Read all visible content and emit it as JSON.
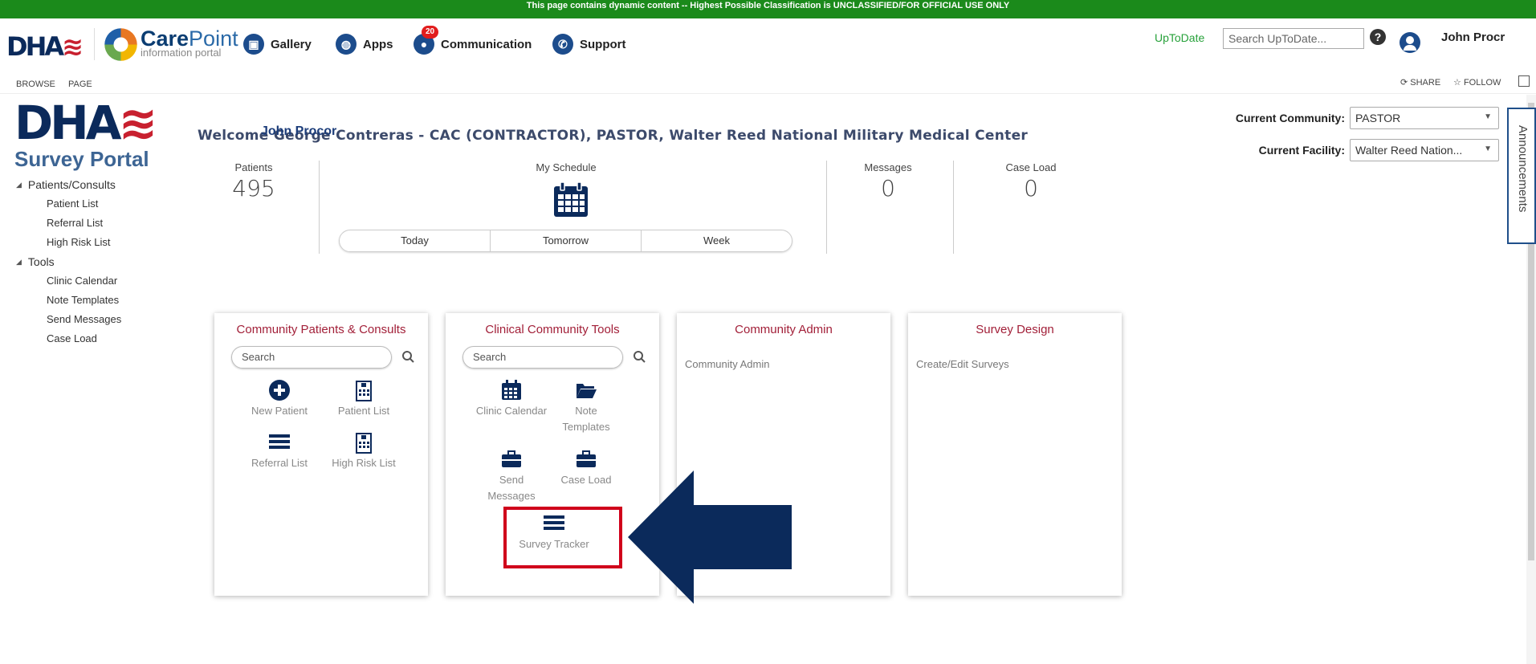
{
  "banner": {
    "text": "This page contains dynamic content -- Highest Possible Classification is UNCLASSIFIED/FOR OFFICIAL USE ONLY"
  },
  "header": {
    "dha_logo": "DHA",
    "carepoint_title": "Care",
    "carepoint_title2": "Point",
    "carepoint_sub": "information portal",
    "nav": [
      {
        "label": "Gallery",
        "icon": "gallery-icon"
      },
      {
        "label": "Apps",
        "icon": "globe-icon"
      },
      {
        "label": "Communication",
        "icon": "chat-icon",
        "badge": "20"
      },
      {
        "label": "Support",
        "icon": "phone-icon"
      }
    ],
    "uptodate": "UpToDate",
    "search_placeholder": "Search UpToDate...",
    "user_name": "John Procr"
  },
  "ribbon": {
    "browse": "BROWSE",
    "page": "PAGE",
    "share": "SHARE",
    "follow": "FOLLOW"
  },
  "sidebar": {
    "logo_text": "DHA",
    "portal_name": "Survey Portal",
    "groups": [
      {
        "label": "Patients/Consults",
        "items": [
          "Patient List",
          "Referral List",
          "High Risk List"
        ]
      },
      {
        "label": "Tools",
        "items": [
          "Clinic Calendar",
          "Note Templates",
          "Send Messages",
          "Case Load"
        ]
      }
    ]
  },
  "main": {
    "welcome": "Welcome George Contreras - CAC (CONTRACTOR), PASTOR, Walter Reed National Military Medical Center",
    "overlay_name": "John Procor",
    "kpis": {
      "patients": {
        "label": "Patients",
        "value": "495"
      },
      "schedule": {
        "label": "My Schedule"
      },
      "messages": {
        "label": "Messages",
        "value": "0"
      },
      "caseload": {
        "label": "Case Load",
        "value": "0"
      }
    },
    "schedule_buttons": [
      "Today",
      "Tomorrow",
      "Week"
    ],
    "community": {
      "label": "Current Community:",
      "value": "PASTOR"
    },
    "facility": {
      "label": "Current Facility:",
      "value": "Walter Reed Nation..."
    },
    "announcements": "Announcements"
  },
  "cards": {
    "patients": {
      "title": "Community Patients & Consults",
      "search": "Search",
      "tiles": [
        "New Patient",
        "Patient List",
        "Referral List",
        "High Risk List"
      ]
    },
    "tools": {
      "title": "Clinical Community Tools",
      "search": "Search",
      "tiles": [
        "Clinic Calendar",
        "Note Templates",
        "Send Messages",
        "Case Load",
        "Survey Tracker"
      ]
    },
    "admin": {
      "title": "Community Admin",
      "link": "Community Admin"
    },
    "design": {
      "title": "Survey Design",
      "link": "Create/Edit Surveys"
    }
  },
  "colors": {
    "banner": "#1b8a1b",
    "navy": "#0b2a5b",
    "card_title": "#a21f38",
    "highlight": "#d0021b",
    "arrow": "#0b2a5b"
  }
}
